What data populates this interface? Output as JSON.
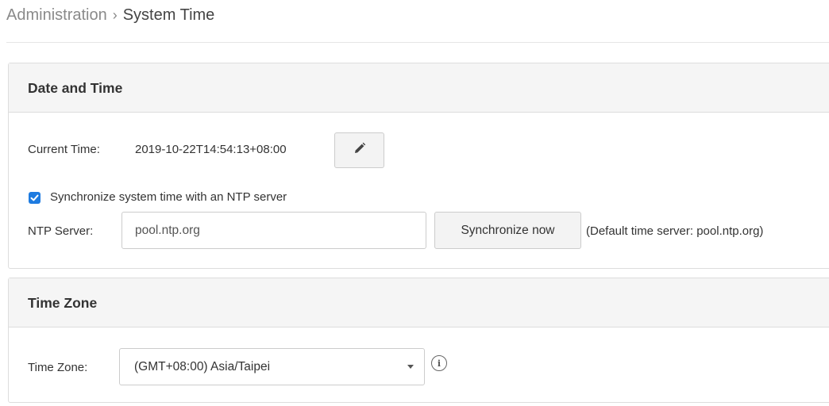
{
  "breadcrumb": {
    "parent": "Administration",
    "separator": "›",
    "current": "System Time"
  },
  "date_time_panel": {
    "title": "Date and Time",
    "current_time_label": "Current Time:",
    "current_time_value": "2019-10-22T14:54:13+08:00",
    "edit_icon": "pencil-icon",
    "sync_checkbox_label": "Synchronize system time with an NTP server",
    "sync_checked": true,
    "ntp_server_label": "NTP Server:",
    "ntp_server_value": "pool.ntp.org",
    "sync_now_label": "Synchronize now",
    "default_server_note": "(Default time server: pool.ntp.org)"
  },
  "time_zone_panel": {
    "title": "Time Zone",
    "time_zone_label": "Time Zone:",
    "time_zone_selected": "(GMT+08:00) Asia/Taipei",
    "info_icon": "info-icon"
  },
  "colors": {
    "accent": "#1e7be0",
    "panel_heading_bg": "#f5f5f5",
    "border": "#dddddd"
  }
}
